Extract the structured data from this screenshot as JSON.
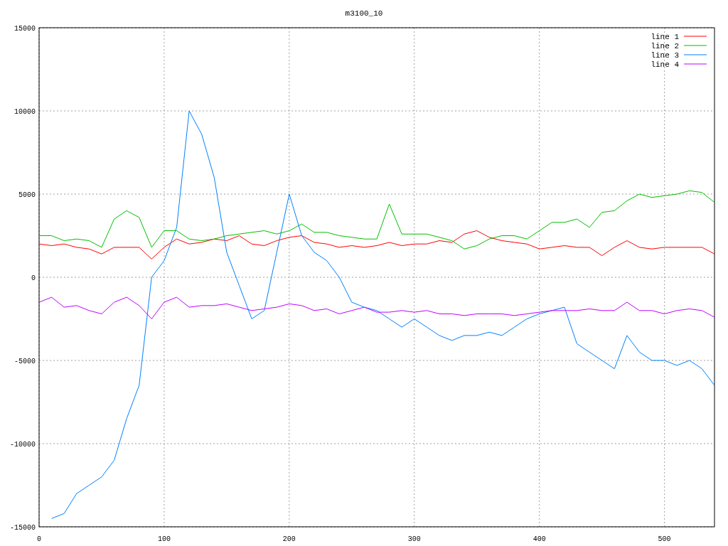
{
  "chart_data": {
    "type": "line",
    "title": "m3100_10",
    "x": [
      0,
      10,
      20,
      30,
      40,
      50,
      60,
      70,
      80,
      90,
      100,
      110,
      120,
      130,
      140,
      150,
      160,
      170,
      180,
      190,
      200,
      210,
      220,
      230,
      240,
      250,
      260,
      270,
      280,
      290,
      300,
      310,
      320,
      330,
      340,
      350,
      360,
      370,
      380,
      390,
      400,
      410,
      420,
      430,
      440,
      450,
      460,
      470,
      480,
      490,
      500,
      510,
      520,
      530,
      540
    ],
    "grid": true,
    "legend": true,
    "xlim": [
      0,
      540
    ],
    "ylim": [
      -15000,
      15000
    ],
    "xticks": [
      0,
      100,
      200,
      300,
      400,
      500
    ],
    "yticks": [
      -15000,
      -10000,
      -5000,
      0,
      5000,
      10000,
      15000
    ],
    "series": [
      {
        "name": "line 1",
        "color": "#ff0000",
        "values": [
          2000,
          1900,
          2000,
          1800,
          1700,
          1400,
          1800,
          1800,
          1800,
          1100,
          1800,
          2300,
          2000,
          2100,
          2300,
          2200,
          2500,
          2000,
          1900,
          2200,
          2400,
          2500,
          2100,
          2000,
          1800,
          1900,
          1800,
          1900,
          2100,
          1900,
          2000,
          2000,
          2200,
          2100,
          2600,
          2800,
          2400,
          2200,
          2100,
          2000,
          1700,
          1800,
          1900,
          1800,
          1800,
          1300,
          1800,
          2200,
          1800,
          1700,
          1800,
          1800,
          1800,
          1800,
          1400
        ]
      },
      {
        "name": "line 2",
        "color": "#00c000",
        "values": [
          2500,
          2500,
          2200,
          2300,
          2200,
          1800,
          3500,
          4000,
          3600,
          1800,
          2800,
          2800,
          2300,
          2200,
          2300,
          2500,
          2600,
          2700,
          2800,
          2600,
          2800,
          3200,
          2700,
          2700,
          2500,
          2400,
          2300,
          2300,
          4400,
          2600,
          2600,
          2600,
          2400,
          2200,
          1700,
          1900,
          2300,
          2500,
          2500,
          2300,
          2800,
          3300,
          3300,
          3500,
          3000,
          3900,
          4000,
          4600,
          5000,
          4800,
          4900,
          5000,
          5200,
          5100,
          4500
        ]
      },
      {
        "name": "line 3",
        "color": "#0080ff",
        "values": [
          null,
          -14500,
          -14200,
          -13000,
          -12500,
          -12000,
          -11000,
          -8500,
          -6500,
          0,
          1000,
          3000,
          10000,
          8600,
          6000,
          1500,
          -500,
          -2500,
          -2000,
          1500,
          5000,
          2500,
          1500,
          1000,
          0,
          -1500,
          -1800,
          -2000,
          -2500,
          -3000,
          -2500,
          -3000,
          -3500,
          -3800,
          -3500,
          -3500,
          -3300,
          -3500,
          -3000,
          -2500,
          -2200,
          -2000,
          -1800,
          -4000,
          -4500,
          -5000,
          -5500,
          -3500,
          -4500,
          -5000,
          -5000,
          -5300,
          -5000,
          -5500,
          -6500
        ]
      },
      {
        "name": "line 4",
        "color": "#c000ff",
        "values": [
          -1500,
          -1200,
          -1800,
          -1700,
          -2000,
          -2200,
          -1500,
          -1200,
          -1700,
          -2500,
          -1500,
          -1200,
          -1800,
          -1700,
          -1700,
          -1600,
          -1800,
          -2000,
          -1900,
          -1800,
          -1600,
          -1700,
          -2000,
          -1900,
          -2200,
          -2000,
          -1800,
          -2100,
          -2100,
          -2000,
          -2100,
          -2000,
          -2200,
          -2200,
          -2300,
          -2200,
          -2200,
          -2200,
          -2300,
          -2200,
          -2100,
          -2000,
          -2000,
          -2000,
          -1900,
          -2000,
          -2000,
          -1500,
          -2000,
          -2000,
          -2200,
          -2000,
          -1900,
          -2000,
          -2400
        ]
      }
    ]
  }
}
